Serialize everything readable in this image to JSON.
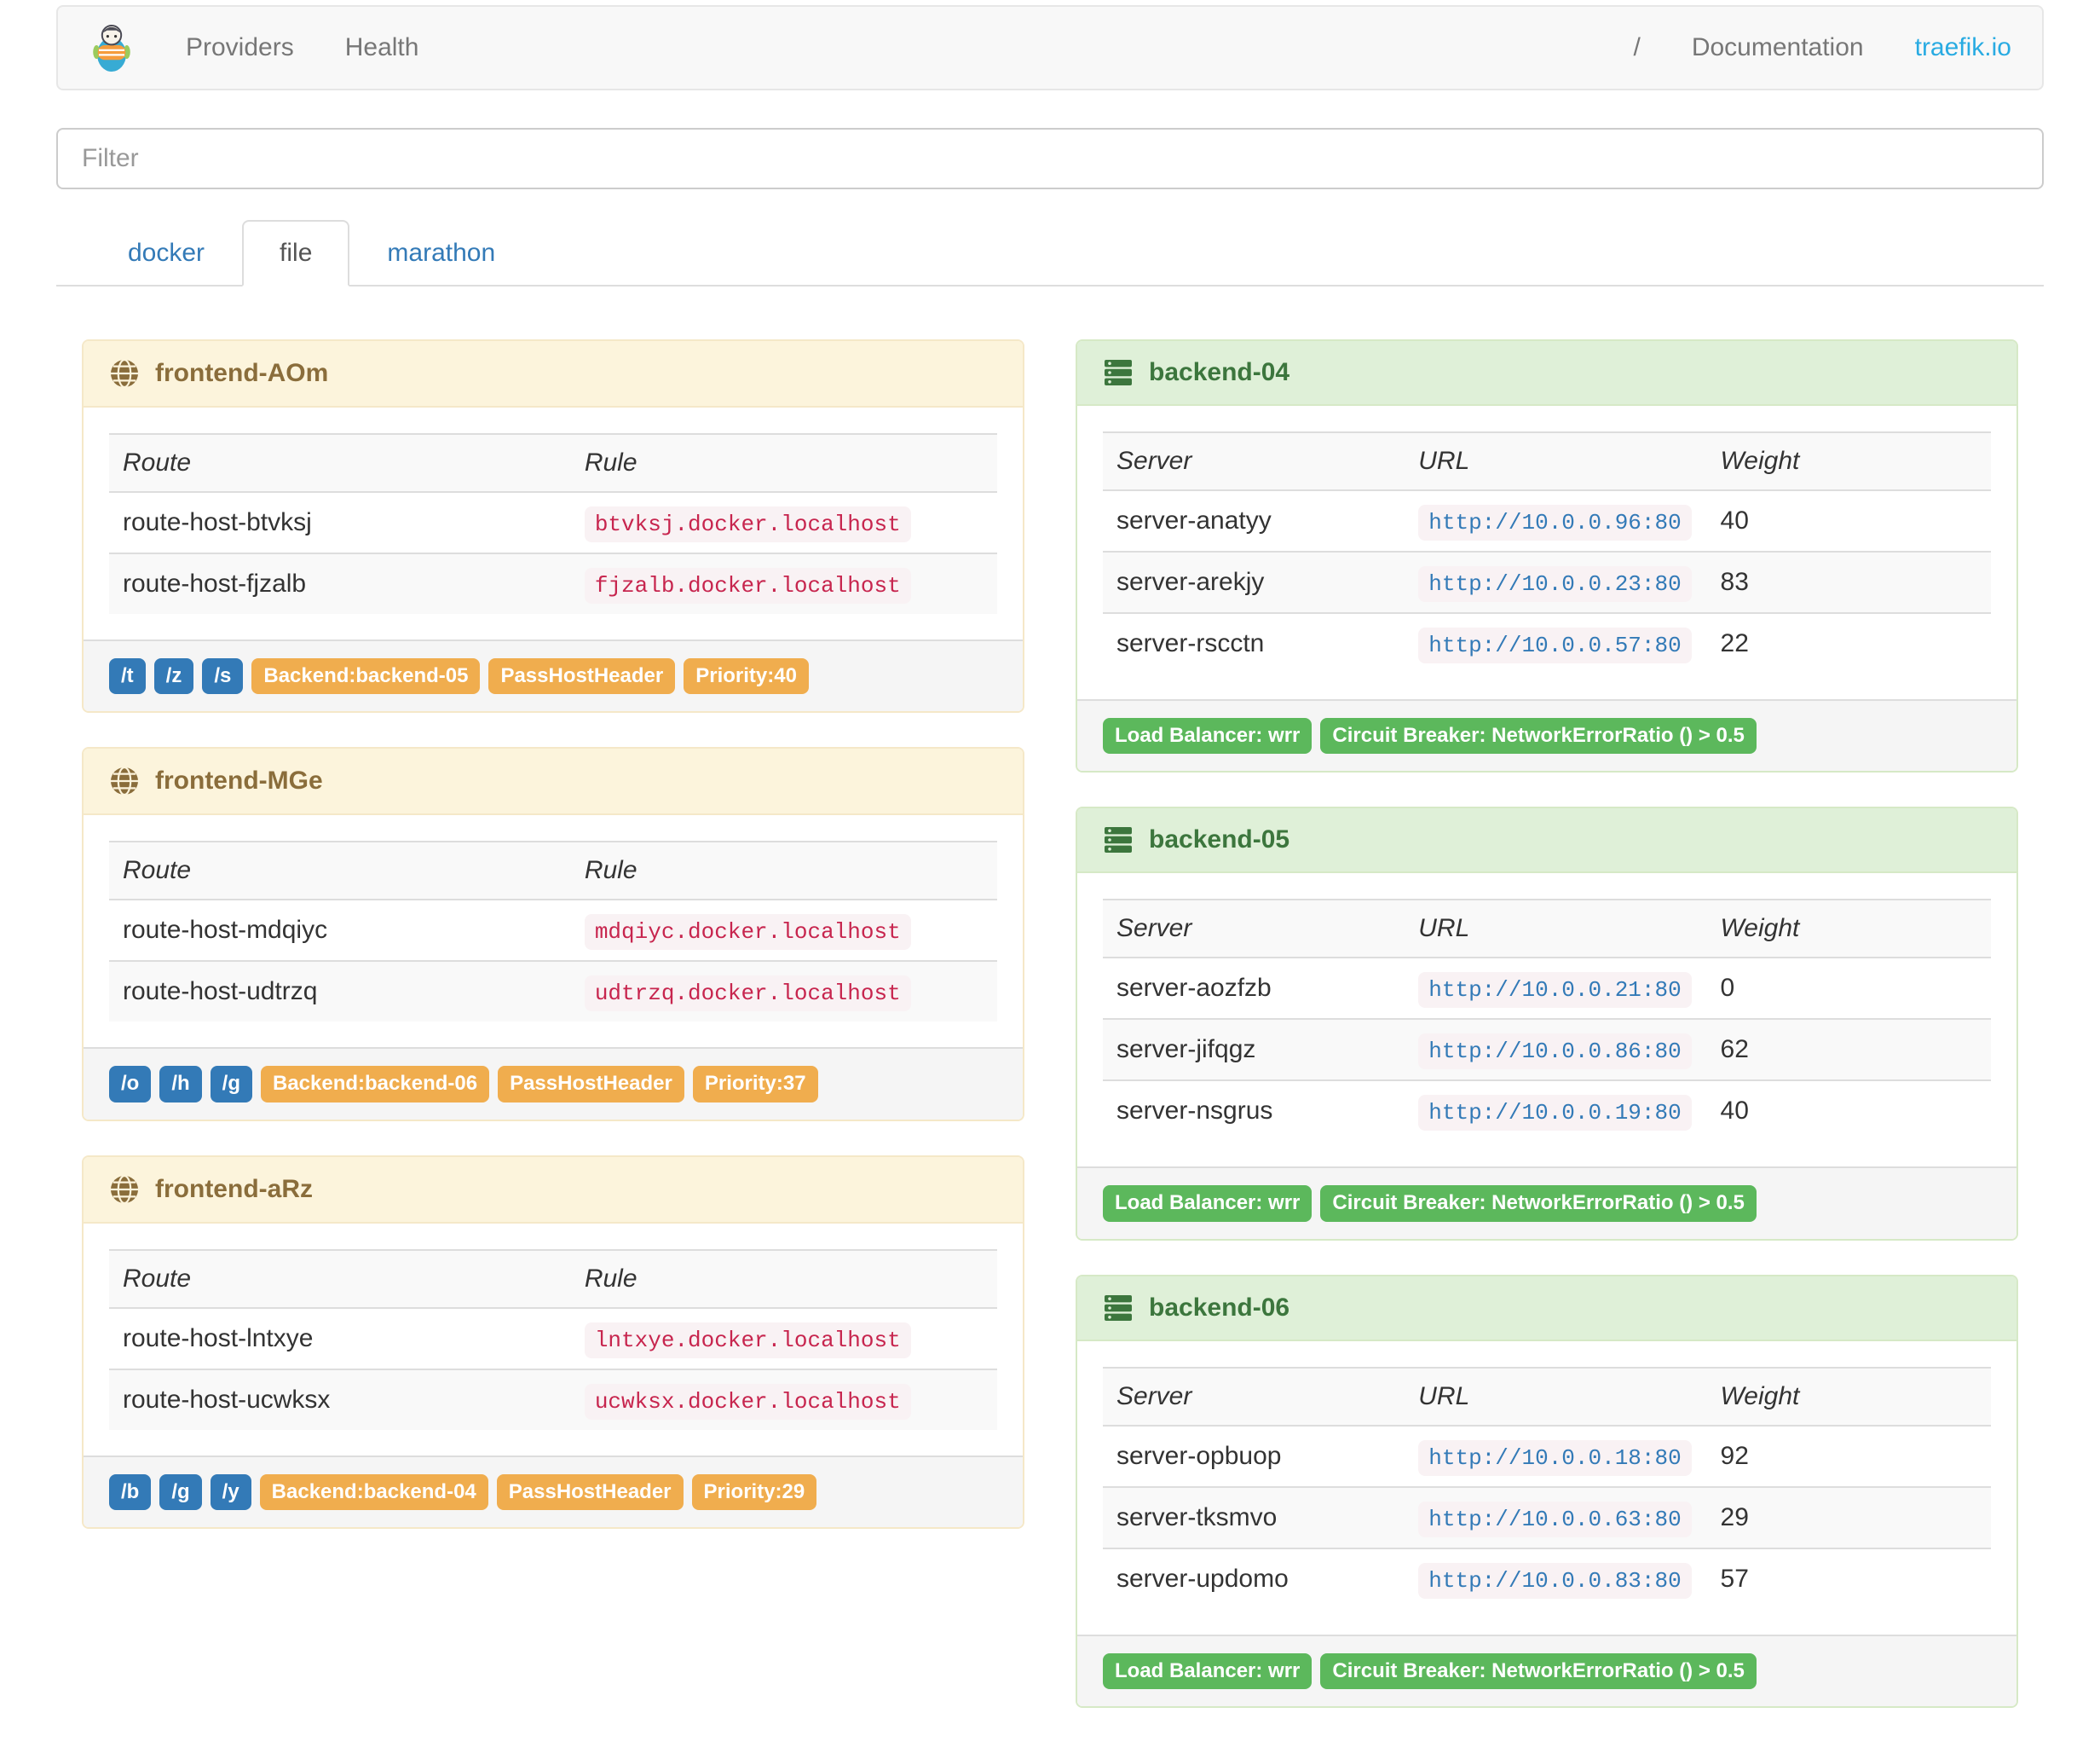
{
  "navbar": {
    "left": [
      "Providers",
      "Health"
    ],
    "right": [
      "/",
      "Documentation",
      "traefik.io"
    ]
  },
  "filter_placeholder": "Filter",
  "tabs": [
    {
      "label": "docker",
      "active": false
    },
    {
      "label": "file",
      "active": true
    },
    {
      "label": "marathon",
      "active": false
    }
  ],
  "frontends": [
    {
      "title": "frontend-AOm",
      "headers": [
        "Route",
        "Rule"
      ],
      "routes": [
        {
          "route": "route-host-btvksj",
          "rule": "btvksj.docker.localhost"
        },
        {
          "route": "route-host-fjzalb",
          "rule": "fjzalb.docker.localhost"
        }
      ],
      "entrypoints": [
        "/t",
        "/z",
        "/s"
      ],
      "tags": [
        "Backend:backend-05",
        "PassHostHeader",
        "Priority:40"
      ]
    },
    {
      "title": "frontend-MGe",
      "headers": [
        "Route",
        "Rule"
      ],
      "routes": [
        {
          "route": "route-host-mdqiyc",
          "rule": "mdqiyc.docker.localhost"
        },
        {
          "route": "route-host-udtrzq",
          "rule": "udtrzq.docker.localhost"
        }
      ],
      "entrypoints": [
        "/o",
        "/h",
        "/g"
      ],
      "tags": [
        "Backend:backend-06",
        "PassHostHeader",
        "Priority:37"
      ]
    },
    {
      "title": "frontend-aRz",
      "headers": [
        "Route",
        "Rule"
      ],
      "routes": [
        {
          "route": "route-host-lntxye",
          "rule": "lntxye.docker.localhost"
        },
        {
          "route": "route-host-ucwksx",
          "rule": "ucwksx.docker.localhost"
        }
      ],
      "entrypoints": [
        "/b",
        "/g",
        "/y"
      ],
      "tags": [
        "Backend:backend-04",
        "PassHostHeader",
        "Priority:29"
      ]
    }
  ],
  "backends": [
    {
      "title": "backend-04",
      "headers": [
        "Server",
        "URL",
        "Weight"
      ],
      "servers": [
        {
          "server": "server-anatyy",
          "url": "http://10.0.0.96:80",
          "weight": "40"
        },
        {
          "server": "server-arekjy",
          "url": "http://10.0.0.23:80",
          "weight": "83"
        },
        {
          "server": "server-rscctn",
          "url": "http://10.0.0.57:80",
          "weight": "22"
        }
      ],
      "footer": [
        "Load Balancer: wrr",
        "Circuit Breaker: NetworkErrorRatio () > 0.5"
      ]
    },
    {
      "title": "backend-05",
      "headers": [
        "Server",
        "URL",
        "Weight"
      ],
      "servers": [
        {
          "server": "server-aozfzb",
          "url": "http://10.0.0.21:80",
          "weight": "0"
        },
        {
          "server": "server-jifqgz",
          "url": "http://10.0.0.86:80",
          "weight": "62"
        },
        {
          "server": "server-nsgrus",
          "url": "http://10.0.0.19:80",
          "weight": "40"
        }
      ],
      "footer": [
        "Load Balancer: wrr",
        "Circuit Breaker: NetworkErrorRatio () > 0.5"
      ]
    },
    {
      "title": "backend-06",
      "headers": [
        "Server",
        "URL",
        "Weight"
      ],
      "servers": [
        {
          "server": "server-opbuop",
          "url": "http://10.0.0.18:80",
          "weight": "92"
        },
        {
          "server": "server-tksmvo",
          "url": "http://10.0.0.63:80",
          "weight": "29"
        },
        {
          "server": "server-updomo",
          "url": "http://10.0.0.83:80",
          "weight": "57"
        }
      ],
      "footer": [
        "Load Balancer: wrr",
        "Circuit Breaker: NetworkErrorRatio () > 0.5"
      ]
    }
  ],
  "colors": {
    "primary_badge": "#337ab7",
    "warning_badge": "#f0ad4e",
    "success_badge": "#5cb85c",
    "frontend_heading_text": "#8a6d3b",
    "backend_heading_text": "#3c763d",
    "rule_code": "#c7254e",
    "url_code": "#337ab7",
    "accent_link": "#29abe2"
  }
}
